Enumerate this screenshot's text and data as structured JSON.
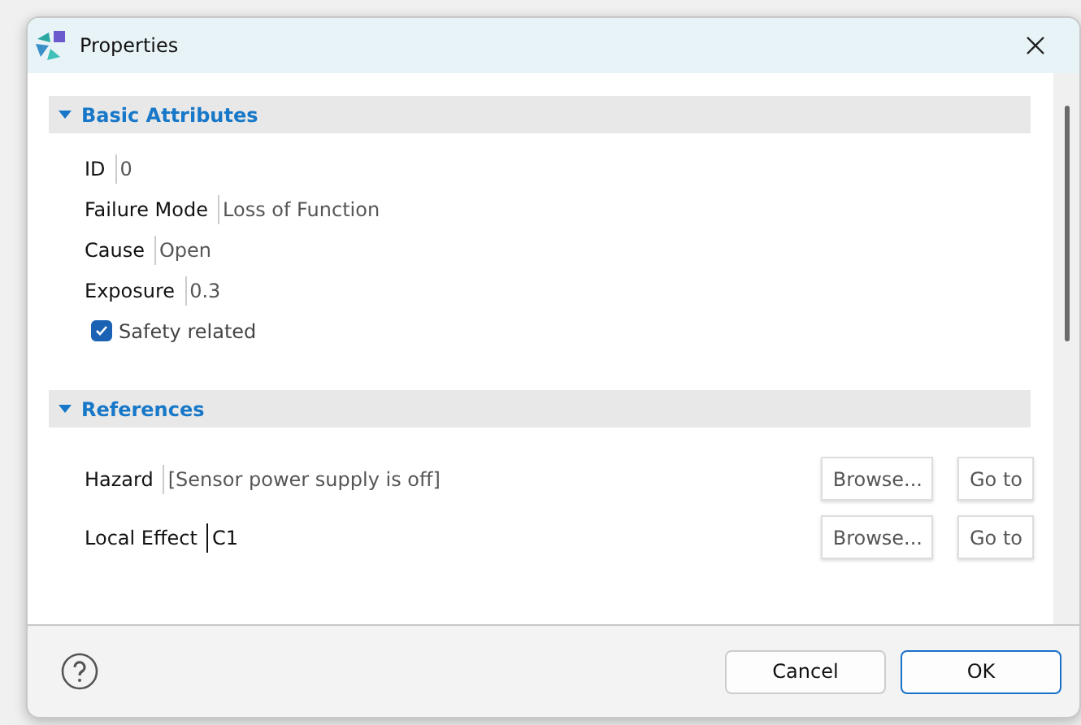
{
  "window": {
    "title": "Properties"
  },
  "sections": [
    {
      "title": "Basic Attributes",
      "expanded": true,
      "fields": [
        {
          "kind": "text",
          "label": "ID",
          "value": "0"
        },
        {
          "kind": "text",
          "label": "Failure Mode",
          "value": "Loss of Function"
        },
        {
          "kind": "text",
          "label": "Cause",
          "value": "Open"
        },
        {
          "kind": "text",
          "label": "Exposure",
          "value": "0.3"
        },
        {
          "kind": "checkbox",
          "label": "Safety related",
          "checked": true
        }
      ]
    },
    {
      "title": "References",
      "expanded": true,
      "fields": [
        {
          "kind": "reference",
          "label": "Hazard",
          "value": "[Sensor power supply is off]",
          "focused": false,
          "buttons": [
            "Browse...",
            "Go to"
          ]
        },
        {
          "kind": "reference",
          "label": "Local Effect",
          "value": "C1",
          "focused": true,
          "buttons": [
            "Browse...",
            "Go to"
          ]
        }
      ]
    }
  ],
  "buttons": [
    {
      "label": "Cancel",
      "default": false
    },
    {
      "label": "OK",
      "default": true
    }
  ]
}
